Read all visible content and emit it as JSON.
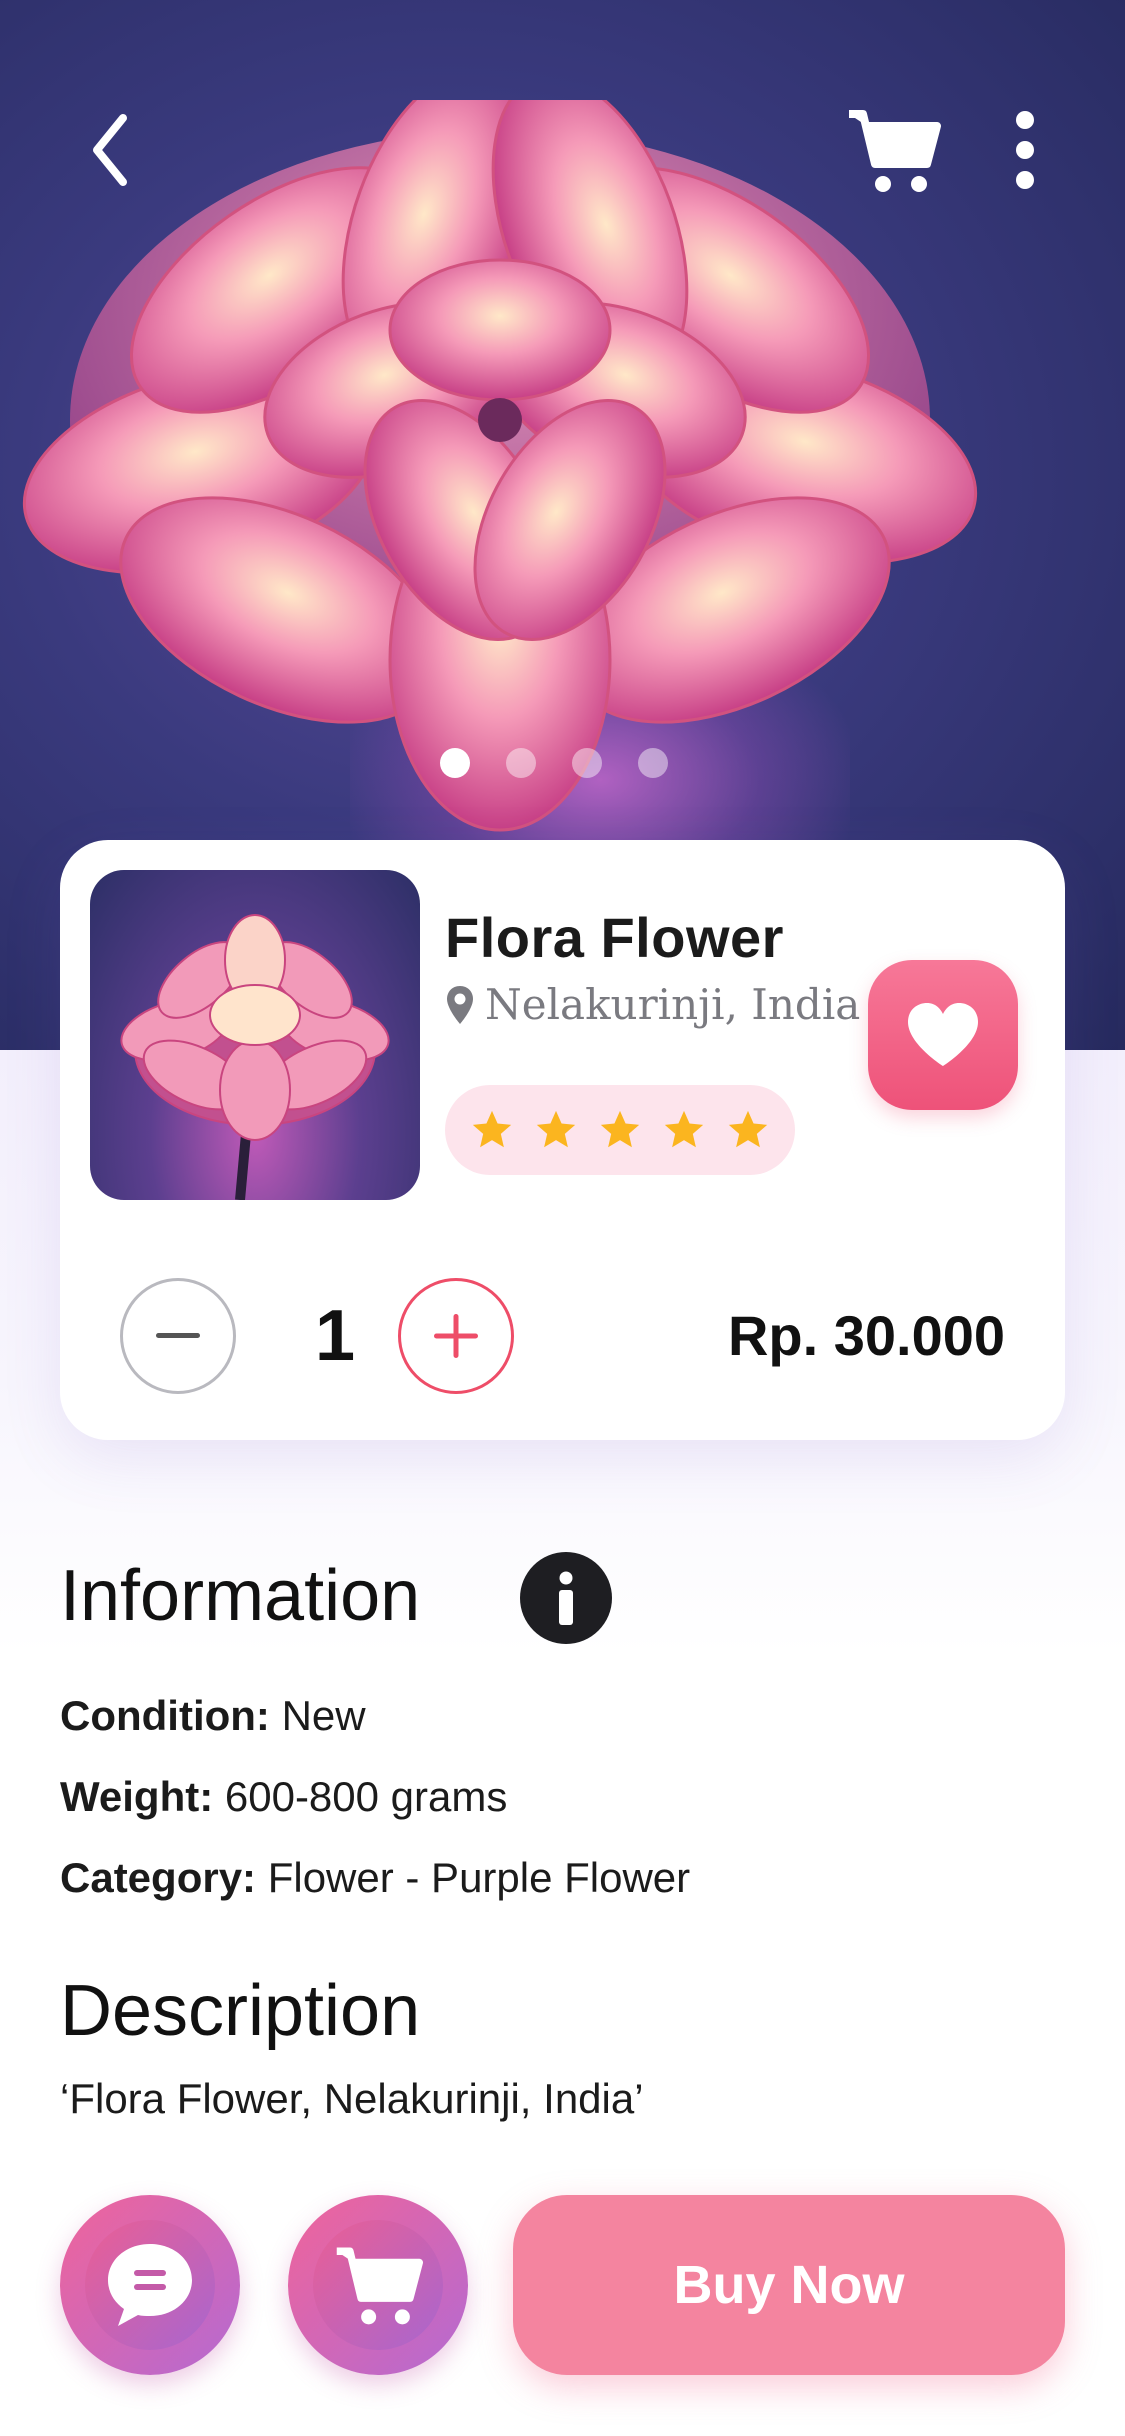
{
  "header": {
    "back_icon": "chevron-left-icon",
    "cart_icon": "cart-icon",
    "more_icon": "vertical-dots-icon",
    "carousel": {
      "count": 4,
      "active_index": 0
    }
  },
  "product": {
    "name": "Flora Flower",
    "location": "Nelakurinji, India",
    "rating": 5,
    "quantity": "1",
    "price": "Rp. 30.000",
    "favorite_icon": "heart-icon"
  },
  "information": {
    "title": "Information",
    "rows": [
      {
        "key": "Condition:",
        "value": " New"
      },
      {
        "key": "Weight:",
        "value": " 600-800 grams"
      },
      {
        "key": "Category:",
        "value": " Flower - Purple Flower"
      }
    ]
  },
  "description": {
    "title": "Description",
    "text": "‘Flora Flower, Nelakurinji, India’"
  },
  "bottom_bar": {
    "chat_icon": "chat-icon",
    "cart_icon": "cart-icon",
    "buy_label": "Buy Now"
  },
  "colors": {
    "accent": "#ee5279",
    "buy_button": "#f4849f",
    "rating_bg": "#fde4ec",
    "star": "#fbb51f",
    "hero_bg": "#2f3168"
  }
}
